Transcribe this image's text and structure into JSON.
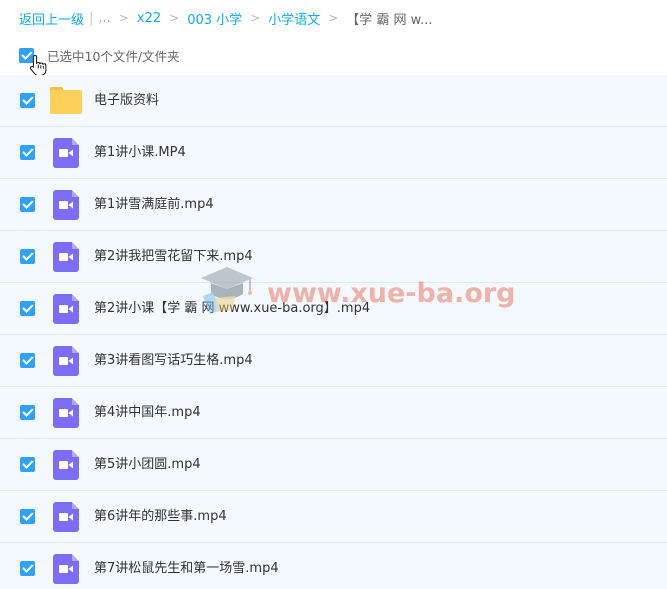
{
  "breadcrumb": {
    "back": "返回上一级",
    "ellipsis": "...",
    "items": [
      "x22",
      "003 小学",
      "小学语文"
    ],
    "current": "【学 霸 网 w..."
  },
  "selection": {
    "text": "已选中10个文件/文件夹",
    "checked": true
  },
  "files": [
    {
      "name": "电子版资料",
      "type": "folder",
      "checked": true
    },
    {
      "name": "第1讲小课.MP4",
      "type": "video",
      "checked": true
    },
    {
      "name": "第1讲雪满庭前.mp4",
      "type": "video",
      "checked": true
    },
    {
      "name": "第2讲我把雪花留下来.mp4",
      "type": "video",
      "checked": true
    },
    {
      "name": "第2讲小课【学 霸 网 www.xue-ba.org】.mp4",
      "type": "video",
      "checked": true
    },
    {
      "name": "第3讲看图写话巧生格.mp4",
      "type": "video",
      "checked": true
    },
    {
      "name": "第4讲中国年.mp4",
      "type": "video",
      "checked": true
    },
    {
      "name": "第5讲小团圆.mp4",
      "type": "video",
      "checked": true
    },
    {
      "name": "第6讲年的那些事.mp4",
      "type": "video",
      "checked": true
    },
    {
      "name": "第7讲松鼠先生和第一场雪.mp4",
      "type": "video",
      "checked": true
    }
  ],
  "watermark": {
    "text": "www.xue-ba.org"
  },
  "colors": {
    "link": "#09AAFF",
    "checkbox": "#2ea1fa",
    "row_bg": "#f3f9ff",
    "folder": "#fbd15b",
    "video": "#7d6cf5"
  }
}
